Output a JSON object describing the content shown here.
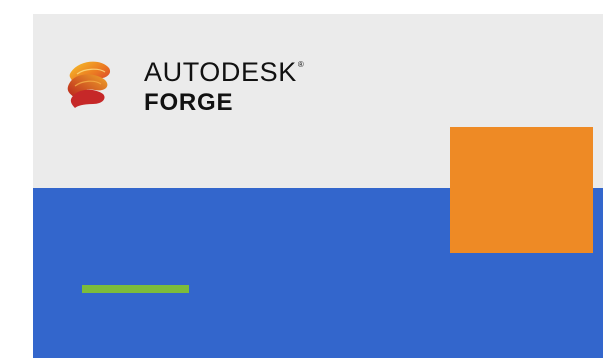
{
  "brand": {
    "company": "AUTODESK",
    "trademark": "®",
    "product": "FORGE",
    "logo_icon": "autodesk-forge-icon"
  },
  "colors": {
    "top_background": "#ebebeb",
    "bottom_background": "#3366cc",
    "accent_orange": "#ee8a25",
    "accent_green": "#7cbc3b",
    "text": "#111111"
  }
}
